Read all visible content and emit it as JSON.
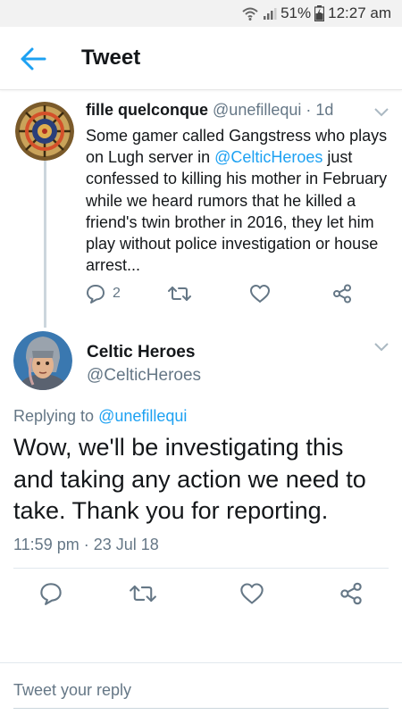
{
  "status_bar": {
    "battery": "51%",
    "time": "12:27 am",
    "icons": [
      "wifi-icon",
      "signal-icon",
      "battery-icon"
    ]
  },
  "header": {
    "title": "Tweet",
    "back_icon": "arrow-left-icon"
  },
  "parent_tweet": {
    "display_name": "fille quelconque",
    "handle": "@unefillequi",
    "separator": " · ",
    "age": "1d",
    "text_before": "Some gamer called Gangstress who plays on Lugh server in ",
    "mention": "@CelticHeroes",
    "text_after": " just confessed to killing his mother in February while we heard rumors that he killed a friend's twin brother in 2016, they let him play without police investigation or house arrest...",
    "reply_count": "2"
  },
  "main_tweet": {
    "display_name": "Celtic Heroes",
    "handle": "@CelticHeroes",
    "replying_label": "Replying to ",
    "replying_to": "@unefillequi",
    "text": "Wow, we'll be investigating this and taking any action we need to take. Thank you for reporting.",
    "timestamp": "11:59 pm · 23 Jul 18"
  },
  "reply": {
    "placeholder": "Tweet your reply"
  },
  "colors": {
    "accent": "#1da1f2",
    "muted": "#657786",
    "text": "#14171a",
    "divider": "#e1e8ed"
  }
}
